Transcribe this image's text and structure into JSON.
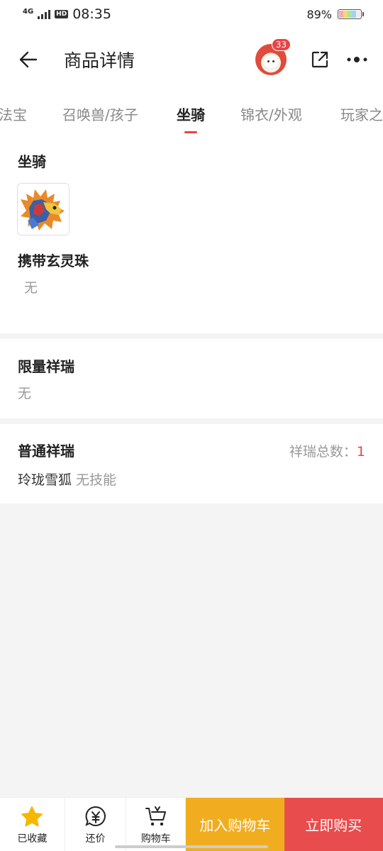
{
  "status_bar": {
    "network": "4G",
    "hd": "HD",
    "time": "08:35",
    "battery_percent": "89%"
  },
  "header": {
    "title": "商品详情",
    "badge_count": "33"
  },
  "tabs": [
    {
      "label": "法宝"
    },
    {
      "label": "召唤兽/孩子"
    },
    {
      "label": "坐骑"
    },
    {
      "label": "锦衣/外观"
    },
    {
      "label": "玩家之"
    }
  ],
  "active_tab": "坐骑",
  "mount_section": {
    "title": "坐骑",
    "carry_title": "携带玄灵珠",
    "carry_value": "无"
  },
  "limited_section": {
    "title": "限量祥瑞",
    "value": "无"
  },
  "normal_section": {
    "title": "普通祥瑞",
    "total_label": "祥瑞总数：",
    "total_value": "1",
    "item_name": "玲珑雪狐",
    "item_skill": "无技能"
  },
  "bottom_bar": {
    "favorite_label": "已收藏",
    "bargain_label": "还价",
    "cart_label": "购物车",
    "add_to_cart": "加入购物车",
    "buy_now": "立即购买"
  },
  "colors": {
    "accent": "#e84545",
    "cart_button": "#f0ad1f",
    "buy_button": "#e84c4c",
    "favorite_star": "#f5b800"
  }
}
